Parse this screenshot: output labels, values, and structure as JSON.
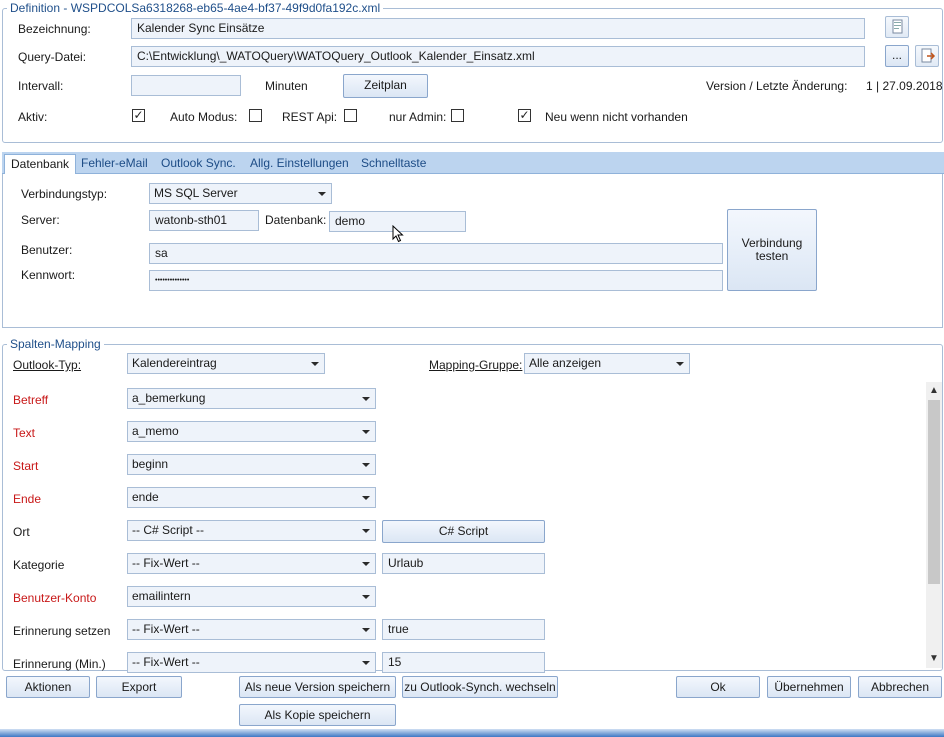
{
  "definition": {
    "title": "Definition - WSPDCOLSa6318268-eb65-4ae4-bf37-49f9d0fa192c.xml",
    "bezeichnung_label": "Bezeichnung:",
    "bezeichnung_value": "Kalender Sync Einsätze",
    "query_label": "Query-Datei:",
    "query_value": "C:\\Entwicklung\\_WATOQuery\\WATOQuery_Outlook_Kalender_Einsatz.xml",
    "browse_label": "...",
    "intervall_label": "Intervall:",
    "intervall_value": "",
    "minuten_label": "Minuten",
    "zeitplan_label": "Zeitplan",
    "version_label": "Version / Letzte Änderung:",
    "version_value": "1 | 27.09.2018",
    "aktiv_label": "Aktiv:",
    "automodus_label": "Auto Modus:",
    "restapi_label": "REST Api:",
    "nuradmin_label": "nur Admin:",
    "neu_label": "Neu wenn nicht vorhanden",
    "checks": {
      "aktiv": "✓",
      "automodus": "",
      "restapi": "",
      "nuradmin": "",
      "neu": "✓"
    }
  },
  "tabs": [
    "Datenbank",
    "Fehler-eMail",
    "Outlook Sync.",
    "Allg. Einstellungen",
    "Schnelltaste"
  ],
  "datenbank": {
    "verbindungstyp_label": "Verbindungstyp:",
    "verbindungstyp_value": "MS SQL Server",
    "server_label": "Server:",
    "server_value": "watonb-sth01",
    "datenbank_label": "Datenbank:",
    "datenbank_value": "demo",
    "benutzer_label": "Benutzer:",
    "benutzer_value": "sa",
    "kennwort_label": "Kennwort:",
    "kennwort_value": "••••••••••••••",
    "test_line1": "Verbindung",
    "test_line2": "testen"
  },
  "mapping": {
    "title": "Spalten-Mapping",
    "outlook_typ_label": "Outlook-Typ:",
    "outlook_typ_value": "Kalendereintrag",
    "gruppe_label": "Mapping-Gruppe:",
    "gruppe_value": "Alle anzeigen",
    "rows": [
      {
        "label": "Betreff",
        "value": "a_bemerkung",
        "extra": ""
      },
      {
        "label": "Text",
        "value": "a_memo",
        "extra": ""
      },
      {
        "label": "Start",
        "value": "beginn",
        "extra": ""
      },
      {
        "label": "Ende",
        "value": "ende",
        "extra": ""
      },
      {
        "label": "Ort",
        "value": "-- C# Script --",
        "extra": "C# Script"
      },
      {
        "label": "Kategorie",
        "value": "-- Fix-Wert --",
        "extra": "Urlaub"
      },
      {
        "label": "Benutzer-Konto",
        "value": "emailintern",
        "extra": ""
      },
      {
        "label": "Erinnerung setzen",
        "value": "-- Fix-Wert --",
        "extra": "true"
      },
      {
        "label": "Erinnerung (Min.)",
        "value": "-- Fix-Wert --",
        "extra": "15"
      }
    ]
  },
  "footer": {
    "aktionen": "Aktionen",
    "export": "Export",
    "neue_version": "Als neue Version speichern",
    "outlook_wechseln": "zu Outlook-Synch. wechseln",
    "kopie": "Als Kopie speichern",
    "ok": "Ok",
    "uebernehmen": "Übernehmen",
    "abbrechen": "Abbrechen"
  },
  "colors": {
    "accent": "#1f4f8a",
    "required": "#c81818",
    "field_bg": "#eef3fa",
    "border": "#a9bdd6"
  }
}
